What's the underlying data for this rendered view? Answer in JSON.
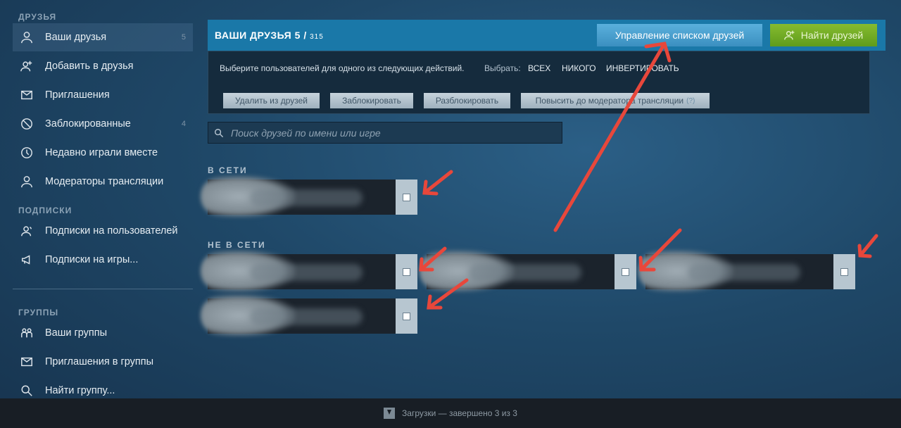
{
  "sidebar": {
    "friends_section": "ДРУЗЬЯ",
    "items": [
      {
        "label": "Ваши друзья",
        "count": "5"
      },
      {
        "label": "Добавить в друзья"
      },
      {
        "label": "Приглашения"
      },
      {
        "label": "Заблокированные",
        "count": "4"
      },
      {
        "label": "Недавно играли вместе"
      },
      {
        "label": "Модераторы трансляции"
      }
    ],
    "subs_section": "ПОДПИСКИ",
    "subs": [
      {
        "label": "Подписки на пользователей"
      },
      {
        "label": "Подписки на игры..."
      }
    ],
    "groups_section": "ГРУППЫ",
    "groups": [
      {
        "label": "Ваши группы"
      },
      {
        "label": "Приглашения в группы"
      },
      {
        "label": "Найти группу..."
      }
    ]
  },
  "header": {
    "title": "ВАШИ ДРУЗЬЯ",
    "count": "5",
    "slash": "/",
    "total": "315",
    "manage_btn": "Управление списком друзей",
    "find_btn": "Найти друзей"
  },
  "actions": {
    "hint": "Выберите пользователей для одного из следующих действий.",
    "select_label": "Выбрать:",
    "all": "ВСЕХ",
    "none": "НИКОГО",
    "invert": "ИНВЕРТИРОВАТЬ",
    "buttons": [
      "Удалить из друзей",
      "Заблокировать",
      "Разблокировать",
      "Повысить до модератора трансляции"
    ],
    "help": "(?)"
  },
  "search": {
    "placeholder": "Поиск друзей по имени или игре"
  },
  "groups": {
    "online": "В СЕТИ",
    "offline": "НЕ В СЕТИ"
  },
  "colors": {
    "accent": "#1a78a8",
    "find_green": "#86bb2f",
    "arrow": "#e8473b"
  },
  "bottom": {
    "downloads": "Загрузки — завершено 3 из 3"
  }
}
